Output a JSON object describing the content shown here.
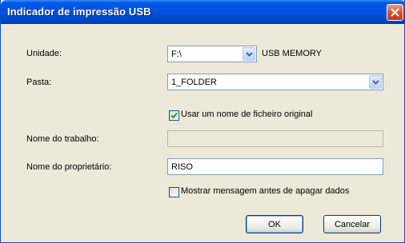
{
  "window": {
    "title": "Indicador de impressão USB"
  },
  "form": {
    "unidade": {
      "label": "Unidade:",
      "value": "F:\\",
      "device": "USB MEMORY"
    },
    "pasta": {
      "label": "Pasta:",
      "value": "1_FOLDER"
    },
    "usar_nome_original": {
      "label": "Usar um nome de ficheiro original",
      "checked": true
    },
    "nome_trabalho": {
      "label": "Nome do trabalho:",
      "value": ""
    },
    "nome_proprietario": {
      "label": "Nome do proprietário:",
      "value": "RISO"
    },
    "mostrar_mensagem": {
      "label": "Mostrar mensagem antes de apagar dados",
      "checked": false
    }
  },
  "buttons": {
    "ok": "OK",
    "cancel": "Cancelar"
  },
  "colors": {
    "titlebar": "#0053df",
    "close": "#d64a25",
    "dialog_bg": "#ece9d8",
    "field_border": "#7f9db9"
  }
}
